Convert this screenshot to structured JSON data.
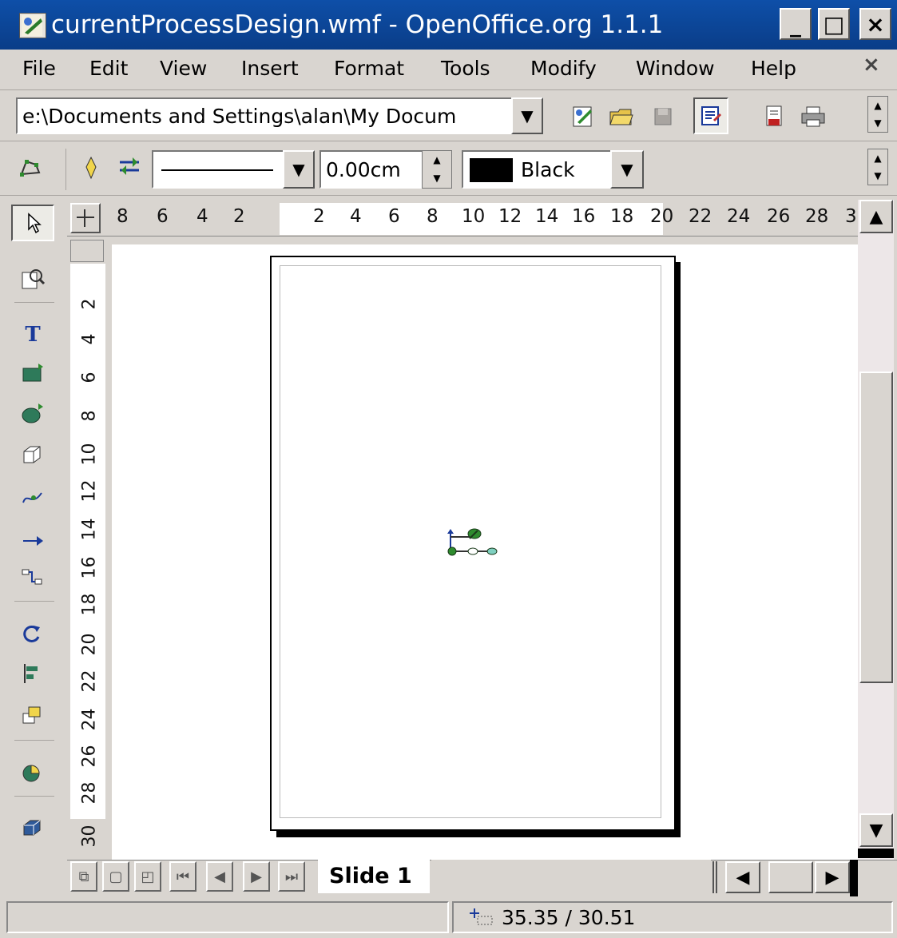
{
  "window": {
    "title": "currentProcessDesign.wmf - OpenOffice.org 1.1.1",
    "minimize": "_",
    "maximize": "□",
    "close": "×"
  },
  "menu": {
    "items": [
      {
        "label": "File"
      },
      {
        "label": "Edit"
      },
      {
        "label": "View"
      },
      {
        "label": "Insert"
      },
      {
        "label": "Format"
      },
      {
        "label": "Tools"
      },
      {
        "label": "Modify"
      },
      {
        "label": "Window"
      },
      {
        "label": "Help"
      }
    ],
    "close_glyph": "×"
  },
  "toolbar": {
    "path": "e:\\Documents and Settings\\alan\\My Docum"
  },
  "line_toolbar": {
    "width_value": "0.00cm",
    "color_name": "Black",
    "color_swatch": "#000000"
  },
  "ruler": {
    "h_ticks": [
      "8",
      "6",
      "4",
      "2",
      "2",
      "4",
      "6",
      "8",
      "10",
      "12",
      "14",
      "16",
      "18",
      "20",
      "22",
      "24",
      "26",
      "28",
      "3"
    ],
    "v_ticks": [
      "2",
      "4",
      "6",
      "8",
      "10",
      "12",
      "14",
      "16",
      "18",
      "20",
      "22",
      "24",
      "26",
      "28",
      "30"
    ]
  },
  "tabs": {
    "slide_label": "Slide 1"
  },
  "status": {
    "position": "35.35 / 30.51"
  },
  "colors": {
    "titlebar": "#0a3d88",
    "chrome": "#d9d5d0"
  }
}
